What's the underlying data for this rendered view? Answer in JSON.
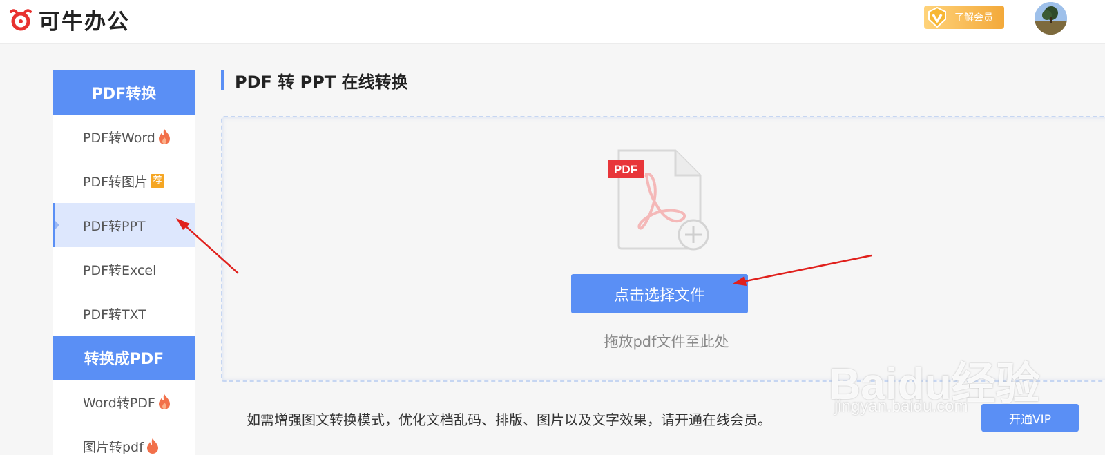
{
  "header": {
    "logo_text": "可牛办公",
    "member_label": "了解会员",
    "avatar_icon": "user-avatar",
    "colors": {
      "member_gradient_start": "#ffd37a",
      "member_gradient_end": "#f3a93a",
      "logo_red": "#e8312f"
    }
  },
  "sidebar": {
    "groups": [
      {
        "title": "PDF转换",
        "items": [
          {
            "label": "PDF转Word",
            "mark": "fire-icon"
          },
          {
            "label": "PDF转图片",
            "mark": "recommend-badge",
            "badge_text": "荐"
          },
          {
            "label": "PDF转PPT",
            "active": true
          },
          {
            "label": "PDF转Excel"
          },
          {
            "label": "PDF转TXT"
          }
        ]
      },
      {
        "title": "转换成PDF",
        "items": [
          {
            "label": "Word转PDF",
            "mark": "fire-icon"
          },
          {
            "label": "图片转pdf",
            "mark": "fire-icon"
          }
        ]
      }
    ]
  },
  "main": {
    "title": "PDF 转 PPT 在线转换",
    "upload": {
      "icon": "pdf-add-file-icon",
      "icon_tag": "PDF",
      "button_label": "点击选择文件",
      "drop_hint": "拖放pdf文件至此处"
    },
    "note": "如需增强图文转换模式，优化文档乱码、排版、图片以及文字效果，请开通在线会员。",
    "vip_button": "开通VIP"
  },
  "watermark": {
    "main": "Baidu经验",
    "sub": "jingyan.baidu.com"
  },
  "colors": {
    "accent": "#5a8ff5",
    "active_bg": "#dde7fd",
    "annotation_arrow": "#e0201c"
  }
}
